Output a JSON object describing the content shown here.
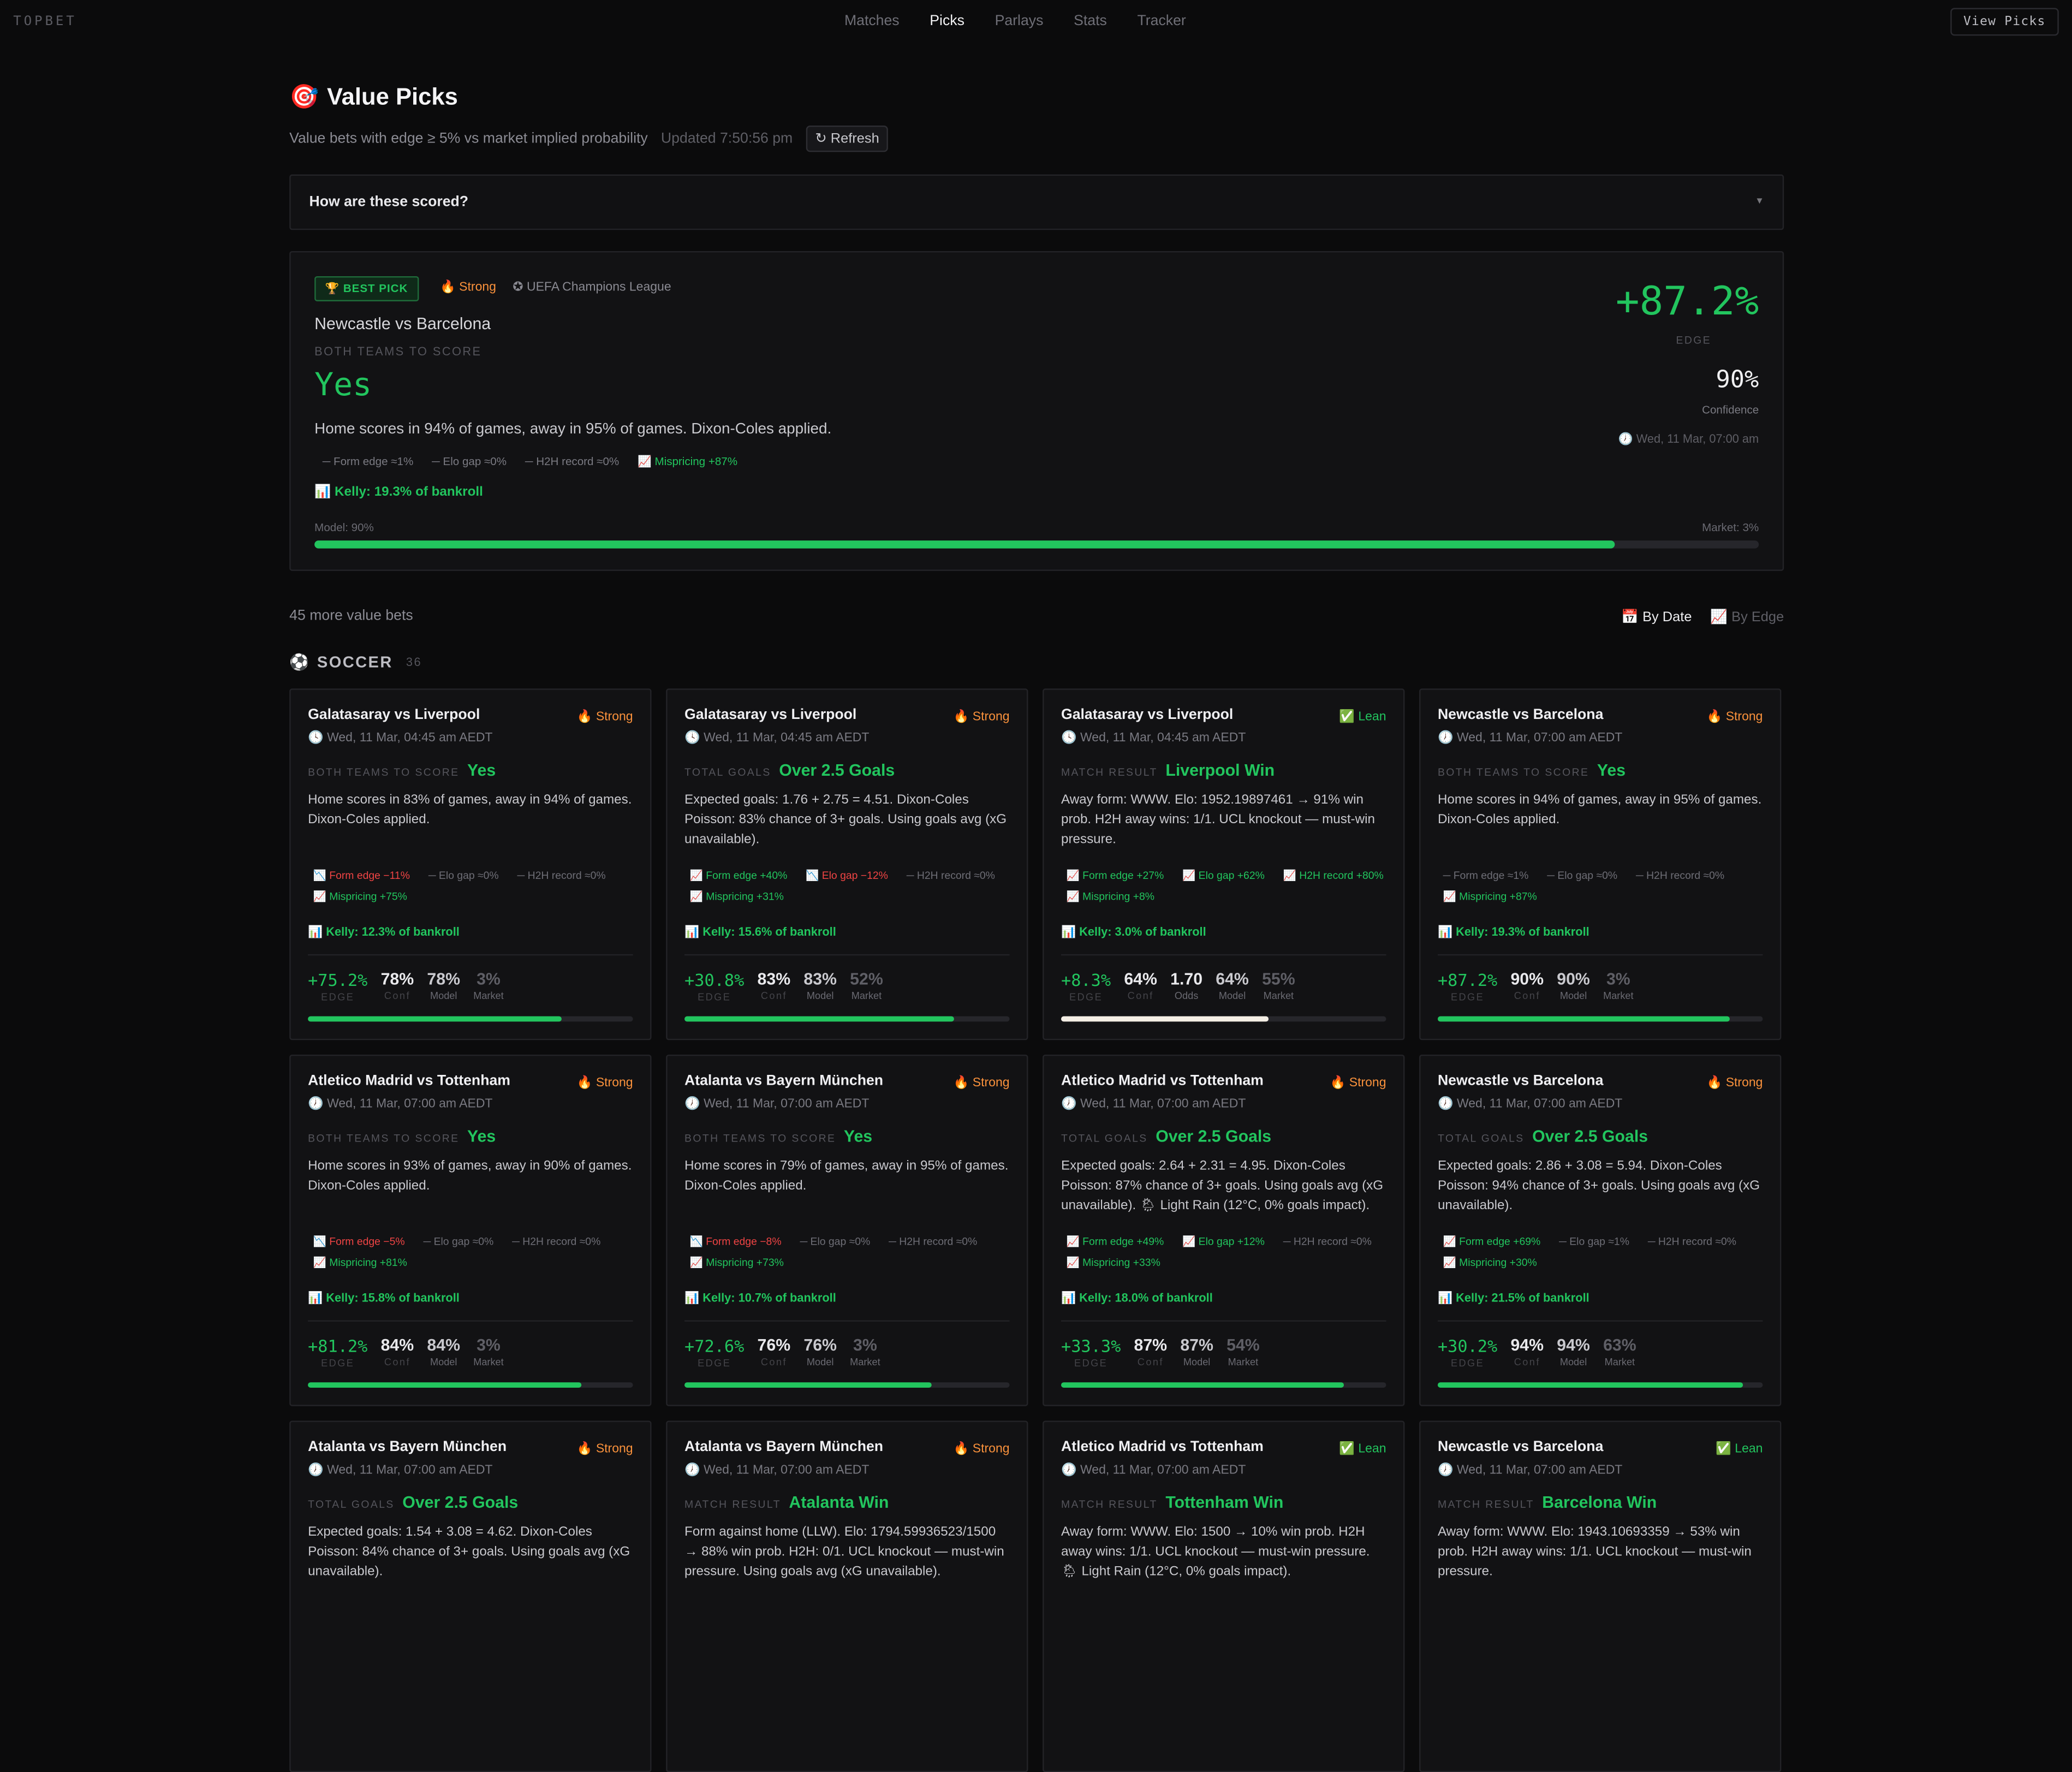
{
  "brand": "TOPBET",
  "nav": [
    "Matches",
    "Picks",
    "Parlays",
    "Stats",
    "Tracker"
  ],
  "nav_active": "Picks",
  "view_button": "View Picks",
  "page": {
    "title": "Value Picks",
    "subtitle": "Value bets with edge ≥ 5% vs market implied probability",
    "updated": "Updated 7:50:56 pm",
    "refresh": "↻ Refresh",
    "how": "How are these scored?"
  },
  "best": {
    "badge": "🏆 BEST PICK",
    "strength": "🔥 Strong",
    "league": "✪ UEFA Champions League",
    "match": "Newcastle vs Barcelona",
    "market": "BOTH TEAMS TO SCORE",
    "pick": "Yes",
    "desc": "Home scores in 94% of games, away in 95% of games. Dixon-Coles applied.",
    "factors": [
      "Form edge ≈1%",
      "Elo gap ≈0%",
      "H2H record ≈0%",
      "Mispricing +87%"
    ],
    "kelly": "📊 Kelly: 19.3% of bankroll",
    "model_label": "Model: 90%",
    "market_label": "Market: 3%",
    "edge": "+87.2%",
    "edge_label": "EDGE",
    "confidence": "90%",
    "confidence_label": "Confidence",
    "when": "🕖 Wed, 11 Mar, 07:00 am",
    "model_fraction": 0.9
  },
  "more": "45 more value bets",
  "sort": {
    "by_date": "📅 By Date",
    "by_edge": "📈 By Edge"
  },
  "sport": {
    "name": "SOCCER",
    "count": "36"
  },
  "labels": {
    "edge": "EDGE",
    "conf": "Conf",
    "odds": "Odds",
    "model": "Model",
    "market": "Market"
  },
  "cards": [
    {
      "match": "Galatasaray vs Liverpool",
      "tag": "🔥 Strong",
      "tag_type": "strong",
      "date": "🕓 Wed, 11 Mar, 04:45 am AEDT",
      "market": "BOTH TEAMS TO SCORE",
      "pick": "Yes",
      "desc": "Home scores in 83% of games, away in 94% of games. Dixon-Coles applied.",
      "factors": [
        {
          "t": "📉 Form edge −11%",
          "c": "neg"
        },
        {
          "t": "─ Elo gap ≈0%",
          "c": ""
        },
        {
          "t": "─ H2H record ≈0%",
          "c": ""
        },
        {
          "t": "📈 Mispricing +75%",
          "c": "pos"
        }
      ],
      "kelly": "📊 Kelly: 12.3% of bankroll",
      "edge": "+75.2%",
      "conf": "78%",
      "odds": "",
      "model": "78%",
      "mkt": "3%",
      "bar": 0.78,
      "bar_color": "green"
    },
    {
      "match": "Galatasaray vs Liverpool",
      "tag": "🔥 Strong",
      "tag_type": "strong",
      "date": "🕓 Wed, 11 Mar, 04:45 am AEDT",
      "market": "TOTAL GOALS",
      "pick": "Over 2.5 Goals",
      "desc": "Expected goals: 1.76 + 2.75 = 4.51. Dixon-Coles Poisson: 83% chance of 3+ goals. Using goals avg (xG unavailable).",
      "factors": [
        {
          "t": "📈 Form edge +40%",
          "c": "pos"
        },
        {
          "t": "📉 Elo gap −12%",
          "c": "neg"
        },
        {
          "t": "─ H2H record ≈0%",
          "c": ""
        },
        {
          "t": "📈 Mispricing +31%",
          "c": "pos"
        }
      ],
      "kelly": "📊 Kelly: 15.6% of bankroll",
      "edge": "+30.8%",
      "conf": "83%",
      "odds": "",
      "model": "83%",
      "mkt": "52%",
      "bar": 0.83,
      "bar_color": "green"
    },
    {
      "match": "Galatasaray vs Liverpool",
      "tag": "✅ Lean",
      "tag_type": "lean",
      "date": "🕓 Wed, 11 Mar, 04:45 am AEDT",
      "market": "MATCH RESULT",
      "pick": "Liverpool Win",
      "desc": "Away form: WWW. Elo: 1952.19897461 → 91% win prob. H2H away wins: 1/1. UCL knockout — must-win pressure.",
      "factors": [
        {
          "t": "📈 Form edge +27%",
          "c": "pos"
        },
        {
          "t": "📈 Elo gap +62%",
          "c": "pos"
        },
        {
          "t": "📈 H2H record +80%",
          "c": "pos"
        },
        {
          "t": "📈 Mispricing +8%",
          "c": "pos"
        }
      ],
      "kelly": "📊 Kelly: 3.0% of bankroll",
      "edge": "+8.3%",
      "conf": "64%",
      "odds": "1.70",
      "model": "64%",
      "mkt": "55%",
      "bar": 0.64,
      "bar_color": "white"
    },
    {
      "match": "Newcastle vs Barcelona",
      "tag": "🔥 Strong",
      "tag_type": "strong",
      "date": "🕖 Wed, 11 Mar, 07:00 am AEDT",
      "market": "BOTH TEAMS TO SCORE",
      "pick": "Yes",
      "desc": "Home scores in 94% of games, away in 95% of games. Dixon-Coles applied.",
      "factors": [
        {
          "t": "─ Form edge ≈1%",
          "c": ""
        },
        {
          "t": "─ Elo gap ≈0%",
          "c": ""
        },
        {
          "t": "─ H2H record ≈0%",
          "c": ""
        },
        {
          "t": "📈 Mispricing +87%",
          "c": "pos"
        }
      ],
      "kelly": "📊 Kelly: 19.3% of bankroll",
      "edge": "+87.2%",
      "conf": "90%",
      "odds": "",
      "model": "90%",
      "mkt": "3%",
      "bar": 0.9,
      "bar_color": "green"
    },
    {
      "match": "Atletico Madrid vs Tottenham",
      "tag": "🔥 Strong",
      "tag_type": "strong",
      "date": "🕖 Wed, 11 Mar, 07:00 am AEDT",
      "market": "BOTH TEAMS TO SCORE",
      "pick": "Yes",
      "desc": "Home scores in 93% of games, away in 90% of games. Dixon-Coles applied.",
      "factors": [
        {
          "t": "📉 Form edge −5%",
          "c": "neg"
        },
        {
          "t": "─ Elo gap ≈0%",
          "c": ""
        },
        {
          "t": "─ H2H record ≈0%",
          "c": ""
        },
        {
          "t": "📈 Mispricing +81%",
          "c": "pos"
        }
      ],
      "kelly": "📊 Kelly: 15.8% of bankroll",
      "edge": "+81.2%",
      "conf": "84%",
      "odds": "",
      "model": "84%",
      "mkt": "3%",
      "bar": 0.84,
      "bar_color": "green"
    },
    {
      "match": "Atalanta vs Bayern München",
      "tag": "🔥 Strong",
      "tag_type": "strong",
      "date": "🕖 Wed, 11 Mar, 07:00 am AEDT",
      "market": "BOTH TEAMS TO SCORE",
      "pick": "Yes",
      "desc": "Home scores in 79% of games, away in 95% of games. Dixon-Coles applied.",
      "factors": [
        {
          "t": "📉 Form edge −8%",
          "c": "neg"
        },
        {
          "t": "─ Elo gap ≈0%",
          "c": ""
        },
        {
          "t": "─ H2H record ≈0%",
          "c": ""
        },
        {
          "t": "📈 Mispricing +73%",
          "c": "pos"
        }
      ],
      "kelly": "📊 Kelly: 10.7% of bankroll",
      "edge": "+72.6%",
      "conf": "76%",
      "odds": "",
      "model": "76%",
      "mkt": "3%",
      "bar": 0.76,
      "bar_color": "green"
    },
    {
      "match": "Atletico Madrid vs Tottenham",
      "tag": "🔥 Strong",
      "tag_type": "strong",
      "date": "🕖 Wed, 11 Mar, 07:00 am AEDT",
      "market": "TOTAL GOALS",
      "pick": "Over 2.5 Goals",
      "desc": "Expected goals: 2.64 + 2.31 = 4.95. Dixon-Coles Poisson: 87% chance of 3+ goals. Using goals avg (xG unavailable). 🌦 Light Rain (12°C, 0% goals impact).",
      "factors": [
        {
          "t": "📈 Form edge +49%",
          "c": "pos"
        },
        {
          "t": "📈 Elo gap +12%",
          "c": "pos"
        },
        {
          "t": "─ H2H record ≈0%",
          "c": ""
        },
        {
          "t": "📈 Mispricing +33%",
          "c": "pos"
        }
      ],
      "kelly": "📊 Kelly: 18.0% of bankroll",
      "edge": "+33.3%",
      "conf": "87%",
      "odds": "",
      "model": "87%",
      "mkt": "54%",
      "bar": 0.87,
      "bar_color": "green"
    },
    {
      "match": "Newcastle vs Barcelona",
      "tag": "🔥 Strong",
      "tag_type": "strong",
      "date": "🕖 Wed, 11 Mar, 07:00 am AEDT",
      "market": "TOTAL GOALS",
      "pick": "Over 2.5 Goals",
      "desc": "Expected goals: 2.86 + 3.08 = 5.94. Dixon-Coles Poisson: 94% chance of 3+ goals. Using goals avg (xG unavailable).",
      "factors": [
        {
          "t": "📈 Form edge +69%",
          "c": "pos"
        },
        {
          "t": "─ Elo gap ≈1%",
          "c": ""
        },
        {
          "t": "─ H2H record ≈0%",
          "c": ""
        },
        {
          "t": "📈 Mispricing +30%",
          "c": "pos"
        }
      ],
      "kelly": "📊 Kelly: 21.5% of bankroll",
      "edge": "+30.2%",
      "conf": "94%",
      "odds": "",
      "model": "94%",
      "mkt": "63%",
      "bar": 0.94,
      "bar_color": "green"
    },
    {
      "match": "Atalanta vs Bayern München",
      "tag": "🔥 Strong",
      "tag_type": "strong",
      "date": "🕖 Wed, 11 Mar, 07:00 am AEDT",
      "market": "TOTAL GOALS",
      "pick": "Over 2.5 Goals",
      "desc": "Expected goals: 1.54 + 3.08 = 4.62. Dixon-Coles Poisson: 84% chance of 3+ goals. Using goals avg (xG unavailable).",
      "factors": [],
      "kelly": "",
      "edge": "",
      "conf": "",
      "odds": "",
      "model": "",
      "mkt": "",
      "bar": 0,
      "bar_color": "green"
    },
    {
      "match": "Atalanta vs Bayern München",
      "tag": "🔥 Strong",
      "tag_type": "strong",
      "date": "🕖 Wed, 11 Mar, 07:00 am AEDT",
      "market": "MATCH RESULT",
      "pick": "Atalanta Win",
      "desc": "Form against home (LLW). Elo: 1794.59936523/1500 → 88% win prob. H2H: 0/1. UCL knockout — must-win pressure. Using goals avg (xG unavailable).",
      "factors": [],
      "kelly": "",
      "edge": "",
      "conf": "",
      "odds": "",
      "model": "",
      "mkt": "",
      "bar": 0,
      "bar_color": "green"
    },
    {
      "match": "Atletico Madrid vs Tottenham",
      "tag": "✅ Lean",
      "tag_type": "lean",
      "date": "🕖 Wed, 11 Mar, 07:00 am AEDT",
      "market": "MATCH RESULT",
      "pick": "Tottenham Win",
      "desc": "Away form: WWW. Elo: 1500 → 10% win prob. H2H away wins: 1/1. UCL knockout — must-win pressure. 🌦 Light Rain (12°C, 0% goals impact).",
      "factors": [],
      "kelly": "",
      "edge": "",
      "conf": "",
      "odds": "",
      "model": "",
      "mkt": "",
      "bar": 0,
      "bar_color": "green"
    },
    {
      "match": "Newcastle vs Barcelona",
      "tag": "✅ Lean",
      "tag_type": "lean",
      "date": "🕖 Wed, 11 Mar, 07:00 am AEDT",
      "market": "MATCH RESULT",
      "pick": "Barcelona Win",
      "desc": "Away form: WWW. Elo: 1943.10693359 → 53% win prob. H2H away wins: 1/1. UCL knockout — must-win pressure.",
      "factors": [],
      "kelly": "",
      "edge": "",
      "conf": "",
      "odds": "",
      "model": "",
      "mkt": "",
      "bar": 0,
      "bar_color": "green"
    }
  ]
}
